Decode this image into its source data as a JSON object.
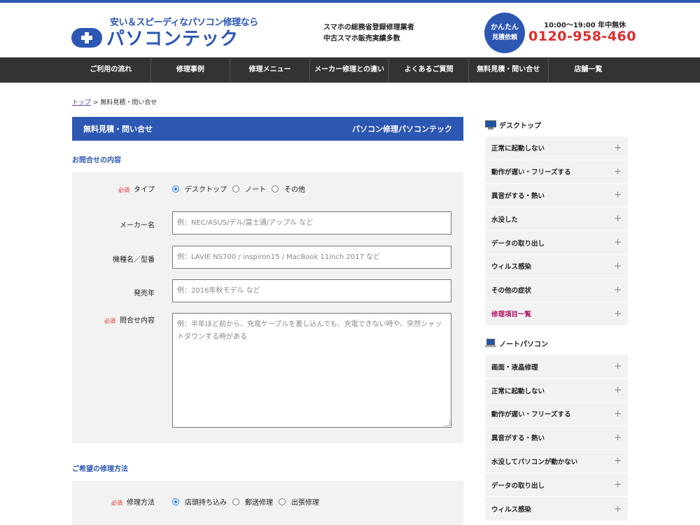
{
  "header": {
    "tagline": "安い＆スピーディなパソコン修理なら",
    "logo_text": "パソコンテック",
    "mid_line1": "スマホの総務省登録修理業者",
    "mid_line2": "中古スマホ販売実績多数",
    "estimate_line1": "かんたん",
    "estimate_line2": "見積依頼",
    "hours": "10:00～19:00 年中無休",
    "phone": "0120-958-460",
    "accent_color": "#2c57b3",
    "phone_color": "#e02b2b"
  },
  "nav": {
    "items": [
      "ご利用の流れ",
      "修理事例",
      "修理メニュー",
      "メーカー修理との違い",
      "よくあるご質問",
      "無料見積・問い合せ",
      "店舗一覧"
    ]
  },
  "breadcrumb": {
    "home": "トップ",
    "separator": ">",
    "current": "無料見積・問い合せ"
  },
  "main": {
    "section_title": "無料見積・問い合せ",
    "section_brand": "パソコン修理パソコンテック",
    "inquiry_title": "お問合せの内容",
    "required_label": "必須",
    "type": {
      "label": "タイプ",
      "options": [
        "デスクトップ",
        "ノート",
        "その他"
      ],
      "selected": "デスクトップ"
    },
    "maker": {
      "label": "メーカー名",
      "placeholder": "例：NEC/ASUS/デル/富士通/アップル など"
    },
    "model": {
      "label": "機種名／型番",
      "placeholder": "例：LAVIE NS700 / inspiron15 / MacBook 11inch 2017 など"
    },
    "release": {
      "label": "発売年",
      "placeholder": "例：2016年秋モデル など"
    },
    "content": {
      "label": "問合せ内容",
      "placeholder": "例：半年ほど前から、充電ケーブルを差し込んでも、充電できない時や、突然シャットダウンする時がある"
    },
    "repair_title": "ご希望の修理方法",
    "method": {
      "label": "修理方法",
      "options": [
        "店頭持ち込み",
        "郵送修理",
        "出張修理"
      ],
      "selected": "店頭持ち込み"
    }
  },
  "sidebar": {
    "desktop_title": "デスクトップ",
    "desktop_items": [
      "正常に起動しない",
      "動作が遅い・フリーズする",
      "異音がする・熱い",
      "水没した",
      "データの取り出し",
      "ウィルス感染",
      "その他の症状",
      "修理項目一覧"
    ],
    "notebook_title": "ノートパソコン",
    "notebook_items": [
      "画面・液晶修理",
      "正常に起動しない",
      "動作が遅い・フリーズする",
      "異音がする・熱い",
      "水没してパソコンが動かない",
      "データの取り出し",
      "ウィルス感染"
    ],
    "plus": "+"
  }
}
